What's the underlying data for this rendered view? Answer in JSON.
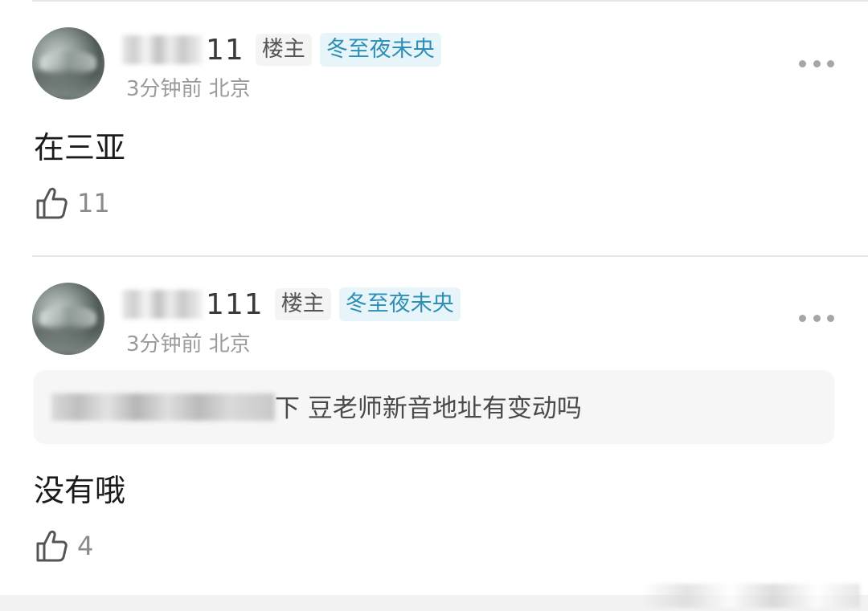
{
  "comments": [
    {
      "username_suffix": "11",
      "owner_tag": "楼主",
      "rank_tag": "冬至夜未央",
      "meta": "3分钟前 北京",
      "body": "在三亚",
      "likes": "11",
      "icons": {
        "more": "more-dots-icon",
        "like": "thumbs-up-icon"
      }
    },
    {
      "username_suffix": "111",
      "owner_tag": "楼主",
      "rank_tag": "冬至夜未央",
      "meta": "3分钟前 北京",
      "quote": "下 豆老师新音地址有变动吗",
      "body": "没有哦",
      "likes": "4",
      "icons": {
        "more": "more-dots-icon",
        "like": "thumbs-up-icon"
      }
    }
  ],
  "colors": {
    "rank_tag_text": "#2d8fb5",
    "rank_tag_bg": "#e7f4f9",
    "meta_text": "#9a9a9a",
    "divider": "#e6e6e6"
  }
}
